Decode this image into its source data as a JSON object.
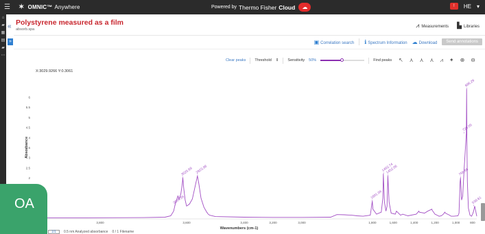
{
  "header": {
    "app_name": "OMNIC™",
    "app_suffix": "Anywhere",
    "powered_by": "Powered by",
    "brand": "Thermo Fisher",
    "cloud": "Cloud",
    "notif_label": "!",
    "help_label": "HE",
    "user_label": "▾"
  },
  "document": {
    "title": "Polystyrene measured as a film",
    "filename": "absorb.spa"
  },
  "nav": {
    "measurements": "Measurements",
    "libraries": "Libraries"
  },
  "actions": {
    "correlation_search": "Correlation search",
    "spectrum_information": "Spectrum Information",
    "download": "Download",
    "send_annotations": "Send annotations"
  },
  "peak_toolbar": {
    "clear_peaks": "Clear peaks",
    "threshold": "Threshold",
    "sensitivity": "Sensitivity",
    "sensitivity_value": "50%",
    "sensitivity_fraction": 0.5,
    "find_peaks": "Find peaks"
  },
  "cursor_readout": "X:3029.9266 Y:0.3061",
  "badge": "OA",
  "bottom": {
    "pager": "1/1",
    "text_a": "0.5 nm Analyzed absorbance",
    "text_b": "0 / 1 Filename"
  },
  "colors": {
    "accent_red": "#c8262e",
    "spectrum": "#a24ec4",
    "link_blue": "#3a78c3",
    "badge_green": "#3aa36b"
  },
  "chart_data": {
    "type": "line",
    "xlabel": "Wavenumbers (cm-1)",
    "ylabel": "Absorbance",
    "x_reversed": true,
    "xlim": [
      4000,
      600
    ],
    "ylim": [
      0,
      7
    ],
    "x_ticks": [
      "3,800",
      "3,600",
      "3,400",
      "3,200",
      "3,000",
      "1,800",
      "1,600",
      "1,400",
      "1,200",
      "1,000",
      "800"
    ],
    "y_ticks": [
      "6",
      "5.5",
      "5",
      "4.5",
      "4",
      "3.5",
      "3",
      "2.5",
      "2",
      "1.5",
      "1",
      "0.5"
    ],
    "series": [
      {
        "x": [
          4000,
          3700,
          3300,
          3150,
          3110,
          3090,
          3082,
          3070,
          3060,
          3052,
          3040,
          3030,
          3026,
          3020,
          3010,
          3000,
          2980,
          2960,
          2940,
          2925,
          2915,
          2900,
          2880,
          2860,
          2850,
          2840,
          2800,
          2600,
          2400,
          2200,
          2000,
          1940,
          1870,
          1800,
          1745,
          1690,
          1620,
          1605,
          1601,
          1595,
          1560,
          1515,
          1500,
          1495,
          1485,
          1470,
          1460,
          1452,
          1440,
          1420,
          1380,
          1370,
          1330,
          1310,
          1260,
          1180,
          1155,
          1150,
          1100,
          1070,
          1030,
          1028,
          1000,
          960,
          940,
          920,
          906,
          900,
          860,
          845,
          820,
          780,
          770,
          760,
          756,
          750,
          745,
          735,
          720,
          700,
          697,
          694,
          690,
          680,
          665,
          650,
          640,
          630,
          620,
          610,
          600
        ],
        "y": [
          0.02,
          0.02,
          0.03,
          0.05,
          0.12,
          0.35,
          0.6,
          0.9,
          1.1,
          0.95,
          1.2,
          1.7,
          2.0,
          1.5,
          0.9,
          0.6,
          0.7,
          0.95,
          1.6,
          2.1,
          1.7,
          1.0,
          0.55,
          0.3,
          0.2,
          0.15,
          0.08,
          0.05,
          0.04,
          0.04,
          0.05,
          0.18,
          0.17,
          0.15,
          0.12,
          0.1,
          0.15,
          0.7,
          0.85,
          0.45,
          0.2,
          0.3,
          1.0,
          2.2,
          0.8,
          0.35,
          0.6,
          2.1,
          0.8,
          0.25,
          0.2,
          0.35,
          0.15,
          0.2,
          0.12,
          0.2,
          0.35,
          0.3,
          0.25,
          0.35,
          0.45,
          0.4,
          0.2,
          0.1,
          0.12,
          0.2,
          0.3,
          0.25,
          0.15,
          0.1,
          0.1,
          0.12,
          0.25,
          1.8,
          2.0,
          1.4,
          0.9,
          1.1,
          2.5,
          4.2,
          6.4,
          3.5,
          1.8,
          0.5,
          0.15,
          0.1,
          0.2,
          0.35,
          0.6,
          0.35,
          0.1
        ]
      }
    ],
    "peak_labels": [
      {
        "x": 3082,
        "y": 0.6,
        "label": "3059.65"
      },
      {
        "x": 3026,
        "y": 2.0,
        "label": "3025.69"
      },
      {
        "x": 2924,
        "y": 2.1,
        "label": "2923.96"
      },
      {
        "x": 1601,
        "y": 0.85,
        "label": "1601.04"
      },
      {
        "x": 1493,
        "y": 2.2,
        "label": "1492.74"
      },
      {
        "x": 1452,
        "y": 2.1,
        "label": "1452.06"
      },
      {
        "x": 756,
        "y": 2.0,
        "label": "756.66"
      },
      {
        "x": 720,
        "y": 4.2,
        "label": "720.05"
      },
      {
        "x": 697,
        "y": 6.4,
        "label": "696.29"
      },
      {
        "x": 630,
        "y": 0.6,
        "label": "539.61"
      }
    ]
  }
}
